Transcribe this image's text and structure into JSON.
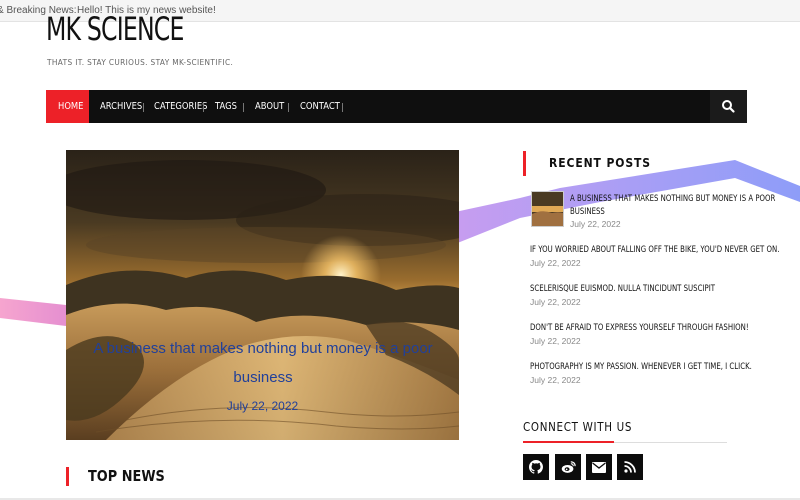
{
  "ticker": {
    "label": "& Breaking News:",
    "text": "Hello! This is my news website!"
  },
  "site": {
    "title": "MK SCIENCE",
    "tagline": "THATS IT. STAY CURIOUS. STAY MK-SCIENTIFIC."
  },
  "nav": {
    "items": [
      "HOME",
      "ARCHIVES",
      "CATEGORIES",
      "TAGS",
      "ABOUT",
      "CONTACT"
    ],
    "active": "HOME",
    "search_icon": "search-icon"
  },
  "hero": {
    "title": "A business that makes nothing but money is a poor business",
    "date": "July 22, 2022"
  },
  "top_news": {
    "heading": "TOP NEWS"
  },
  "sidebar": {
    "recent_posts_heading": "RECENT POSTS",
    "posts": [
      {
        "title_line1": "A BUSINESS THAT MAKES NOTHING BUT MONEY IS A POOR",
        "title_line2": "BUSINESS",
        "date": "July 22, 2022"
      },
      {
        "title": "IF YOU WORRIED ABOUT FALLING OFF THE BIKE, YOU'D NEVER GET ON.",
        "date": "July 22, 2022"
      },
      {
        "title": "SCELERISQUE EUISMOD. NULLA TINCIDUNT SUSCIPIT",
        "date": "July 22, 2022"
      },
      {
        "title": "DON'T BE AFRAID TO EXPRESS YOURSELF THROUGH FASHION!",
        "date": "July 22, 2022"
      },
      {
        "title": "PHOTOGRAPHY IS MY PASSION. WHENEVER I GET TIME, I CLICK.",
        "date": "July 22, 2022"
      }
    ],
    "connect_heading": "CONNECT WITH US",
    "social_icons": [
      "github-icon",
      "weibo-icon",
      "mail-icon",
      "rss-icon"
    ]
  },
  "colors": {
    "accent": "#ed2128",
    "nav_bg": "#0f0f0f",
    "hero_text": "#21409a"
  }
}
